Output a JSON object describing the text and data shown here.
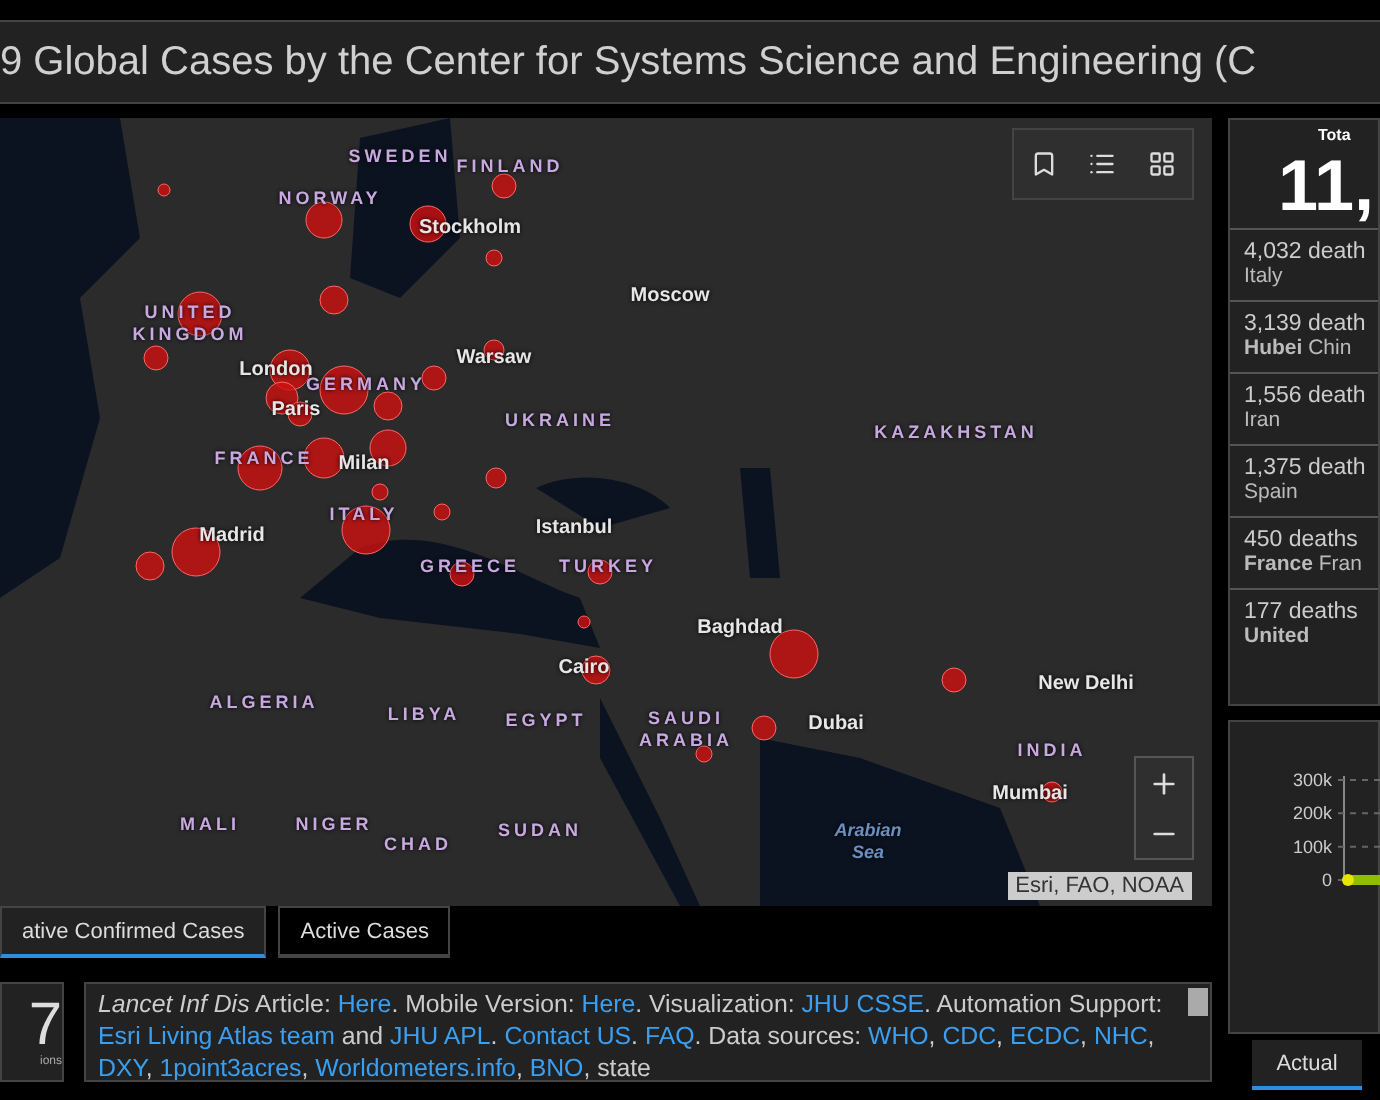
{
  "title": "9 Global Cases by the Center for Systems Science and Engineering (C",
  "map": {
    "labels": [
      {
        "text": "SWEDEN",
        "kind": "country"
      },
      {
        "text": "FINLAND",
        "kind": "country"
      },
      {
        "text": "NORWAY",
        "kind": "country"
      },
      {
        "text": "Stockholm",
        "kind": "city"
      },
      {
        "text": "UNITED KINGDOM",
        "kind": "country"
      },
      {
        "text": "Moscow",
        "kind": "city"
      },
      {
        "text": "London",
        "kind": "city"
      },
      {
        "text": "GERMANY",
        "kind": "country"
      },
      {
        "text": "Warsaw",
        "kind": "city"
      },
      {
        "text": "Paris",
        "kind": "city"
      },
      {
        "text": "UKRAINE",
        "kind": "country"
      },
      {
        "text": "KAZAKHSTAN",
        "kind": "country"
      },
      {
        "text": "FRANCE",
        "kind": "country"
      },
      {
        "text": "Milan",
        "kind": "city"
      },
      {
        "text": "ITALY",
        "kind": "country"
      },
      {
        "text": "Madrid",
        "kind": "city"
      },
      {
        "text": "Istanbul",
        "kind": "city"
      },
      {
        "text": "GREECE",
        "kind": "country"
      },
      {
        "text": "TURKEY",
        "kind": "country"
      },
      {
        "text": "Baghdad",
        "kind": "city"
      },
      {
        "text": "Cairo",
        "kind": "city"
      },
      {
        "text": "New Delhi",
        "kind": "city"
      },
      {
        "text": "ALGERIA",
        "kind": "country"
      },
      {
        "text": "LIBYA",
        "kind": "country"
      },
      {
        "text": "EGYPT",
        "kind": "country"
      },
      {
        "text": "SAUDI ARABIA",
        "kind": "country"
      },
      {
        "text": "Dubai",
        "kind": "city"
      },
      {
        "text": "INDIA",
        "kind": "country"
      },
      {
        "text": "Mumbai",
        "kind": "city"
      },
      {
        "text": "MALI",
        "kind": "country"
      },
      {
        "text": "NIGER",
        "kind": "country"
      },
      {
        "text": "CHAD",
        "kind": "country"
      },
      {
        "text": "SUDAN",
        "kind": "country"
      },
      {
        "text": "Arabian Sea",
        "kind": "sea"
      }
    ],
    "attribution": "Esri, FAO, NOAA"
  },
  "map_tabs": [
    {
      "label": "ative Confirmed Cases",
      "selected": true
    },
    {
      "label": "Active Cases",
      "selected": false
    }
  ],
  "counter": {
    "value": "7",
    "caption": "ions"
  },
  "info": [
    {
      "text": "Lancet Inf Dis",
      "kind": "italic"
    },
    {
      "text": " Article: ",
      "kind": "text"
    },
    {
      "text": "Here",
      "kind": "link"
    },
    {
      "text": ". Mobile Version: ",
      "kind": "text"
    },
    {
      "text": "Here",
      "kind": "link"
    },
    {
      "text": ". Visualization: ",
      "kind": "text"
    },
    {
      "text": "JHU CSSE",
      "kind": "link"
    },
    {
      "text": ". Automation Support: ",
      "kind": "text"
    },
    {
      "text": "Esri Living Atlas team",
      "kind": "link"
    },
    {
      "text": " and ",
      "kind": "text"
    },
    {
      "text": "JHU APL",
      "kind": "link"
    },
    {
      "text": ". ",
      "kind": "text"
    },
    {
      "text": "Contact US",
      "kind": "link"
    },
    {
      "text": ". ",
      "kind": "text"
    },
    {
      "text": "FAQ",
      "kind": "link"
    },
    {
      "text": ". Data sources: ",
      "kind": "text"
    },
    {
      "text": "WHO",
      "kind": "link"
    },
    {
      "text": ", ",
      "kind": "text"
    },
    {
      "text": "CDC",
      "kind": "link"
    },
    {
      "text": ", ",
      "kind": "text"
    },
    {
      "text": "ECDC",
      "kind": "link"
    },
    {
      "text": ", ",
      "kind": "text"
    },
    {
      "text": "NHC",
      "kind": "link"
    },
    {
      "text": ", ",
      "kind": "text"
    },
    {
      "text": "DXY",
      "kind": "link"
    },
    {
      "text": ", ",
      "kind": "text"
    },
    {
      "text": "1point3acres",
      "kind": "link"
    },
    {
      "text": ", ",
      "kind": "text"
    },
    {
      "text": "Worldometers.info",
      "kind": "link"
    },
    {
      "text": ", ",
      "kind": "text"
    },
    {
      "text": "BNO",
      "kind": "link"
    },
    {
      "text": ", state",
      "kind": "text"
    }
  ],
  "deaths": {
    "header": "Tota",
    "total": "11,",
    "rows": [
      {
        "count": "4,032 death",
        "place": "Italy"
      },
      {
        "count": "3,139 death",
        "place": "**Hubei** Chin"
      },
      {
        "count": "1,556 death",
        "place": "Iran"
      },
      {
        "count": "1,375 death",
        "place": "Spain"
      },
      {
        "count": "450 deaths",
        "place": "**France** Fran"
      },
      {
        "count": "177 deaths",
        "place": "**United**"
      }
    ]
  },
  "chart": {
    "axis_labels": [
      "300k",
      "200k",
      "100k",
      "0"
    ]
  },
  "chart_tabs": [
    {
      "label": "Actual",
      "selected": true
    }
  ]
}
